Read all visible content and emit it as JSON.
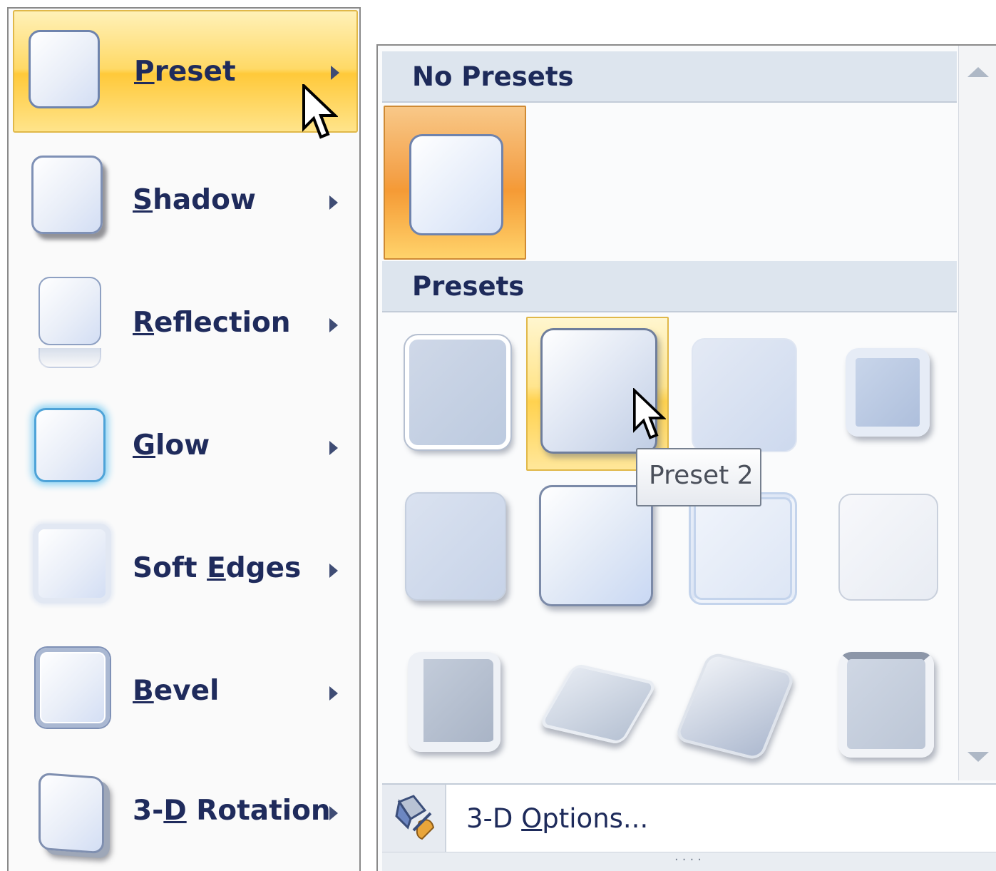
{
  "menu": {
    "items": [
      {
        "label": "Preset",
        "accel": "P",
        "highlighted": true
      },
      {
        "label": "Shadow",
        "accel": "S"
      },
      {
        "label": "Reflection",
        "accel": "R"
      },
      {
        "label": "Glow",
        "accel": "G"
      },
      {
        "label": "Soft Edges",
        "accel": "E"
      },
      {
        "label": "Bevel",
        "accel": "B"
      },
      {
        "label": "3-D Rotation",
        "accel": "D"
      }
    ]
  },
  "gallery": {
    "no_presets_header": "No Presets",
    "presets_header": "Presets",
    "tooltip": "Preset 2",
    "hovered_preset": "Preset 2",
    "footer_label": "3-D Options...",
    "grip": "····"
  },
  "colors": {
    "highlight_gold": "#ffd966",
    "selected_orange": "#f59a35",
    "text_navy": "#1d2a5a"
  }
}
